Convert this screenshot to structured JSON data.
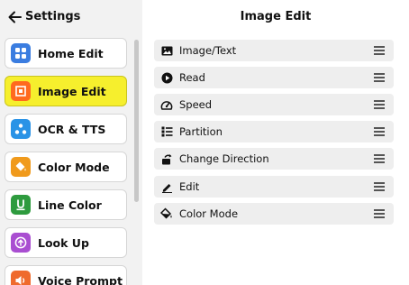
{
  "sidebar": {
    "title": "Settings",
    "items": [
      {
        "label": "Home Edit",
        "icon": "grid-icon",
        "color": "#3b7de0"
      },
      {
        "label": "Image Edit",
        "icon": "crop-frame-icon",
        "color": "#ff6a1e",
        "selected": true
      },
      {
        "label": "OCR & TTS",
        "icon": "nodes-icon",
        "color": "#2a93e6"
      },
      {
        "label": "Color Mode",
        "icon": "paint-bucket-icon",
        "color": "#f09a1c"
      },
      {
        "label": "Line Color",
        "icon": "underline-icon",
        "color": "#2e9b3e"
      },
      {
        "label": "Look Up",
        "icon": "upload-circle-icon",
        "color": "#a94ed1"
      },
      {
        "label": "Voice Prompt",
        "icon": "speaker-icon",
        "color": "#ef6a2c"
      }
    ]
  },
  "main": {
    "title": "Image Edit",
    "rows": [
      {
        "label": "Image/Text",
        "icon": "image-icon"
      },
      {
        "label": "Read",
        "icon": "play-circle-icon"
      },
      {
        "label": "Speed",
        "icon": "speedometer-icon"
      },
      {
        "label": "Partition",
        "icon": "list-icon"
      },
      {
        "label": "Change Direction",
        "icon": "rotate-icon"
      },
      {
        "label": "Edit",
        "icon": "pen-icon"
      },
      {
        "label": "Color Mode",
        "icon": "paint-bucket-icon"
      }
    ]
  },
  "colors": {
    "selected_bg": "#f6ef2d",
    "sidebar_bg": "#f2f2f2",
    "row_bg": "#eeeeee"
  }
}
